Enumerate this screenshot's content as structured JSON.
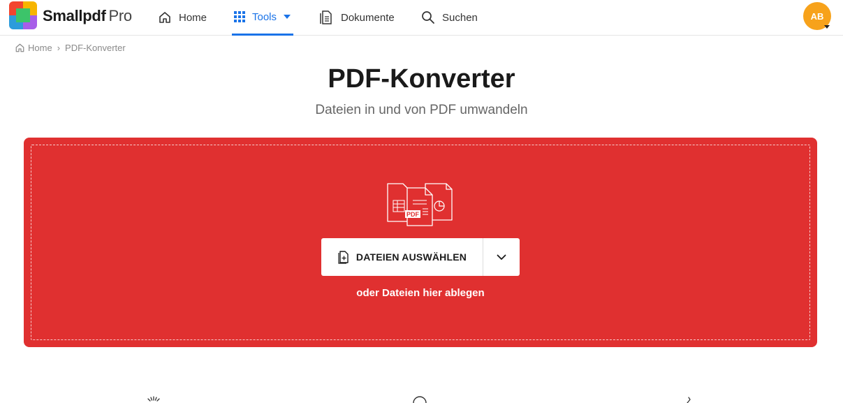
{
  "brand": {
    "name": "Smallpdf",
    "tier": "Pro"
  },
  "nav": {
    "home": "Home",
    "tools": "Tools",
    "documents": "Dokumente",
    "search": "Suchen"
  },
  "user": {
    "initials": "AB"
  },
  "breadcrumb": {
    "home": "Home",
    "separator": "›",
    "current": "PDF-Konverter"
  },
  "main": {
    "title": "PDF-Konverter",
    "subtitle": "Dateien in und von PDF umwandeln"
  },
  "dropzone": {
    "choose_label": "DATEIEN AUSWÄHLEN",
    "hint": "oder Dateien hier ablegen",
    "illustration_badge": "PDF"
  },
  "colors": {
    "accent": "#1a73e8",
    "dropzone": "#e03030",
    "avatar": "#f7a21b"
  }
}
